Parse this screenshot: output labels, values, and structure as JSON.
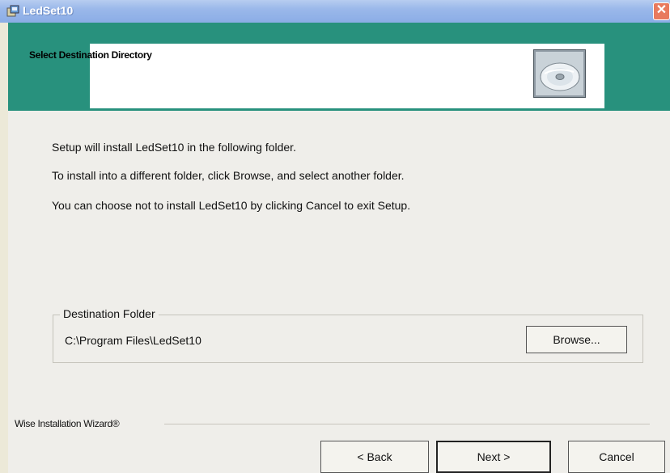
{
  "window": {
    "title": "LedSet10",
    "close_label": "✕"
  },
  "header": {
    "title": "Select Destination Directory"
  },
  "body": {
    "lines": [
      "Setup will install LedSet10 in the following folder.",
      "To install into a different folder, click Browse, and select another folder.",
      "You can choose not to install LedSet10 by clicking Cancel to exit Setup."
    ]
  },
  "destination": {
    "legend": "Destination Folder",
    "path": "C:\\Program Files\\LedSet10",
    "browse_label": "Browse..."
  },
  "footer": {
    "brand": "Wise Installation Wizard®",
    "back_label": "< Back",
    "next_label": "Next >",
    "cancel_label": "Cancel"
  },
  "icons": {
    "app": "installer-icon",
    "header": "cd-disc-icon",
    "close": "close-icon"
  },
  "colors": {
    "header_band": "#28917d",
    "title_bar": "#9ab8ea",
    "close_button": "#e87a5e",
    "dialog_bg": "#efeeea"
  }
}
